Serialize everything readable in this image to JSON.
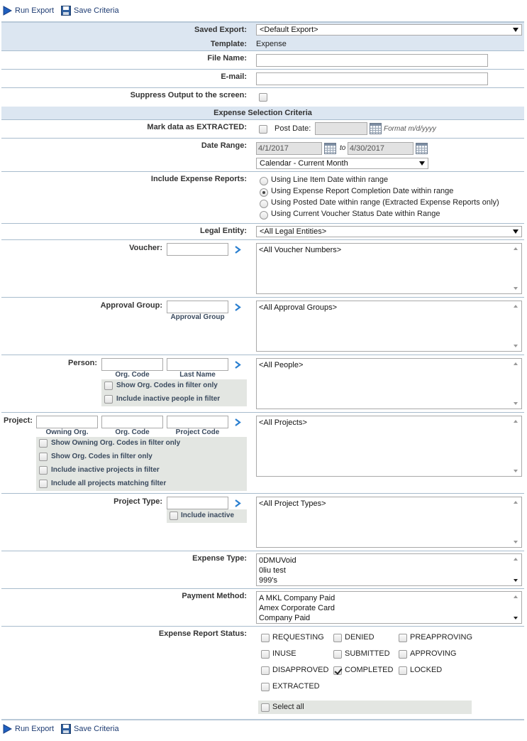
{
  "toolbar": {
    "run_export": "Run Export",
    "save_criteria": "Save Criteria"
  },
  "saved_export": {
    "label": "Saved Export:",
    "value": "<Default Export>"
  },
  "template": {
    "label": "Template:",
    "value": "Expense"
  },
  "file_name": {
    "label": "File Name:",
    "value": ""
  },
  "email": {
    "label": "E-mail:",
    "value": ""
  },
  "suppress": {
    "label": "Suppress Output to the screen:",
    "checked": false
  },
  "section_title": "Expense Selection Criteria",
  "mark_extracted": {
    "label": "Mark data as EXTRACTED:",
    "checked": false,
    "post_date_label": "Post Date:",
    "post_date_value": "",
    "format_hint": "Format m/d/yyyy"
  },
  "date_range": {
    "label": "Date Range:",
    "from": "4/1/2017",
    "to_label": "to",
    "to": "4/30/2017",
    "preset": "Calendar - Current Month"
  },
  "include_reports": {
    "label": "Include Expense Reports:",
    "options": [
      {
        "label": "Using Line Item Date within range",
        "selected": false
      },
      {
        "label": "Using Expense Report Completion Date within range",
        "selected": true
      },
      {
        "label": "Using Posted Date within range (Extracted Expense Reports only)",
        "selected": false
      },
      {
        "label": "Using Current Voucher Status Date within Range",
        "selected": false
      }
    ]
  },
  "legal_entity": {
    "label": "Legal Entity:",
    "value": "<All Legal Entities>"
  },
  "voucher": {
    "label": "Voucher:",
    "filter": "",
    "list": [
      "<All Voucher Numbers>"
    ]
  },
  "approval_group": {
    "label": "Approval Group:",
    "filter": "",
    "sub_label": "Approval Group",
    "list": [
      "<All Approval Groups>"
    ]
  },
  "person": {
    "label": "Person:",
    "sub_labels": [
      "Org. Code",
      "Last Name"
    ],
    "options": [
      {
        "label": "Show Org. Codes in filter only",
        "checked": false
      },
      {
        "label": "Include inactive people in filter",
        "checked": false
      }
    ],
    "list": [
      "<All People>"
    ]
  },
  "project": {
    "label": "Project:",
    "sub_labels": [
      "Owning Org.",
      "Org. Code",
      "Project Code"
    ],
    "options": [
      {
        "label": "Show Owning Org. Codes in filter only",
        "checked": false
      },
      {
        "label": "Show Org. Codes in filter only",
        "checked": false
      },
      {
        "label": "Include inactive projects in filter",
        "checked": false
      },
      {
        "label": "Include all projects matching filter",
        "checked": false
      }
    ],
    "list": [
      "<All Projects>"
    ]
  },
  "project_type": {
    "label": "Project Type:",
    "include_inactive": "Include inactive",
    "list": [
      "<All Project Types>"
    ]
  },
  "expense_type": {
    "label": "Expense Type:",
    "list": [
      "0DMUVoid",
      "0liu test",
      "999's"
    ]
  },
  "payment_method": {
    "label": "Payment Method:",
    "list": [
      "A MKL Company Paid",
      "Amex Corporate Card",
      "Company Paid"
    ]
  },
  "report_status": {
    "label": "Expense Report Status:",
    "statuses": [
      {
        "label": "REQUESTING",
        "checked": false
      },
      {
        "label": "DENIED",
        "checked": false
      },
      {
        "label": "PREAPPROVING",
        "checked": false
      },
      {
        "label": "INUSE",
        "checked": false
      },
      {
        "label": "SUBMITTED",
        "checked": false
      },
      {
        "label": "APPROVING",
        "checked": false
      },
      {
        "label": "DISAPPROVED",
        "checked": false
      },
      {
        "label": "COMPLETED",
        "checked": true
      },
      {
        "label": "LOCKED",
        "checked": false
      },
      {
        "label": "EXTRACTED",
        "checked": false
      }
    ],
    "select_all": "Select all"
  },
  "colors": {
    "accent": "#1f6fbf",
    "band": "#dce6f1",
    "label": "#333333",
    "gray_panel": "#e3e6e2"
  }
}
